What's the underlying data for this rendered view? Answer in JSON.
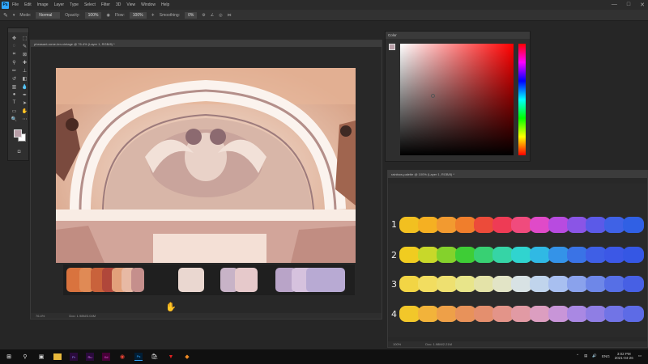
{
  "menubar": {
    "logo": "Ps",
    "items": [
      "File",
      "Edit",
      "Image",
      "Layer",
      "Type",
      "Select",
      "Filter",
      "3D",
      "View",
      "Window",
      "Help"
    ],
    "window_controls": [
      "—",
      "□",
      "✕"
    ]
  },
  "options": {
    "mode_label": "Mode:",
    "mode_value": "Normal",
    "opacity_label": "Opacity:",
    "opacity_value": "100%",
    "flow_label": "Flow:",
    "flow_value": "100%",
    "smoothing_label": "Smoothing:",
    "smoothing_value": "0%"
  },
  "document": {
    "tab_title": "pheasant-rome-ten-vintage @ 76.4% (Layer 1, RGB/8) *",
    "zoom": "76.4%",
    "doc_size": "Doc: 1.98M/3.04M"
  },
  "color_panel": {
    "tab": "Color",
    "foreground": "#b89ea7"
  },
  "rainbow_doc": {
    "tab_title": "rainbow-palette @ 100% (Layer 1, RGB/8) *",
    "zoom": "100%",
    "doc_size": "Doc: 1.98M/2.21M",
    "row_labels": [
      "1",
      "2",
      "3",
      "4"
    ]
  },
  "palette": {
    "colors": [
      "#d9733e",
      "#e08a55",
      "#c9623b",
      "#b0473a",
      "#e2a07a",
      "#e7b9a4",
      "#c58f8c",
      "#ead7d0",
      "#c8b3c7",
      "#e6c9cb",
      "#b9a4c8",
      "#d6c2de",
      "#b8aad3"
    ]
  },
  "rainbow_rows": [
    [
      "#f2c020",
      "#f5b022",
      "#f29a30",
      "#f07e2c",
      "#ec4b3a",
      "#ee3b55",
      "#f04b7d",
      "#e04ac8",
      "#b84be0",
      "#8a55e6",
      "#5b5ae8",
      "#3f62e6",
      "#3060e4"
    ],
    [
      "#f0cc20",
      "#c8d82a",
      "#84d22c",
      "#3ecd36",
      "#38d073",
      "#36d4a6",
      "#30d4cf",
      "#30b9e4",
      "#3493e8",
      "#3a73e6",
      "#3f5fe6",
      "#3c58e6",
      "#3557e4"
    ],
    [
      "#f2d545",
      "#f2dd60",
      "#eee070",
      "#e8e58a",
      "#e4e3a8",
      "#e2e4c6",
      "#d8e2e4",
      "#c0d4ec",
      "#a8bff0",
      "#8aa2ec",
      "#6e87e8",
      "#566fe6",
      "#4760e4"
    ],
    [
      "#f2c72a",
      "#f2b33a",
      "#eea048",
      "#e8925a",
      "#e48f6e",
      "#e39489",
      "#e19aa4",
      "#dc9ec0",
      "#c895d8",
      "#a988e3",
      "#8f7ee4",
      "#7174e6",
      "#5d6be6"
    ]
  ],
  "taskbar": {
    "icons": [
      "windows-logo",
      "search",
      "task-view",
      "file-explorer",
      "premiere-pro",
      "premiere-rush",
      "adobe-xd",
      "chrome",
      "photoshop",
      "store",
      "ads-app",
      "orange-app"
    ],
    "tray_lang": "ENG",
    "time": "3:02 PM",
    "date": "2021-04-26"
  }
}
